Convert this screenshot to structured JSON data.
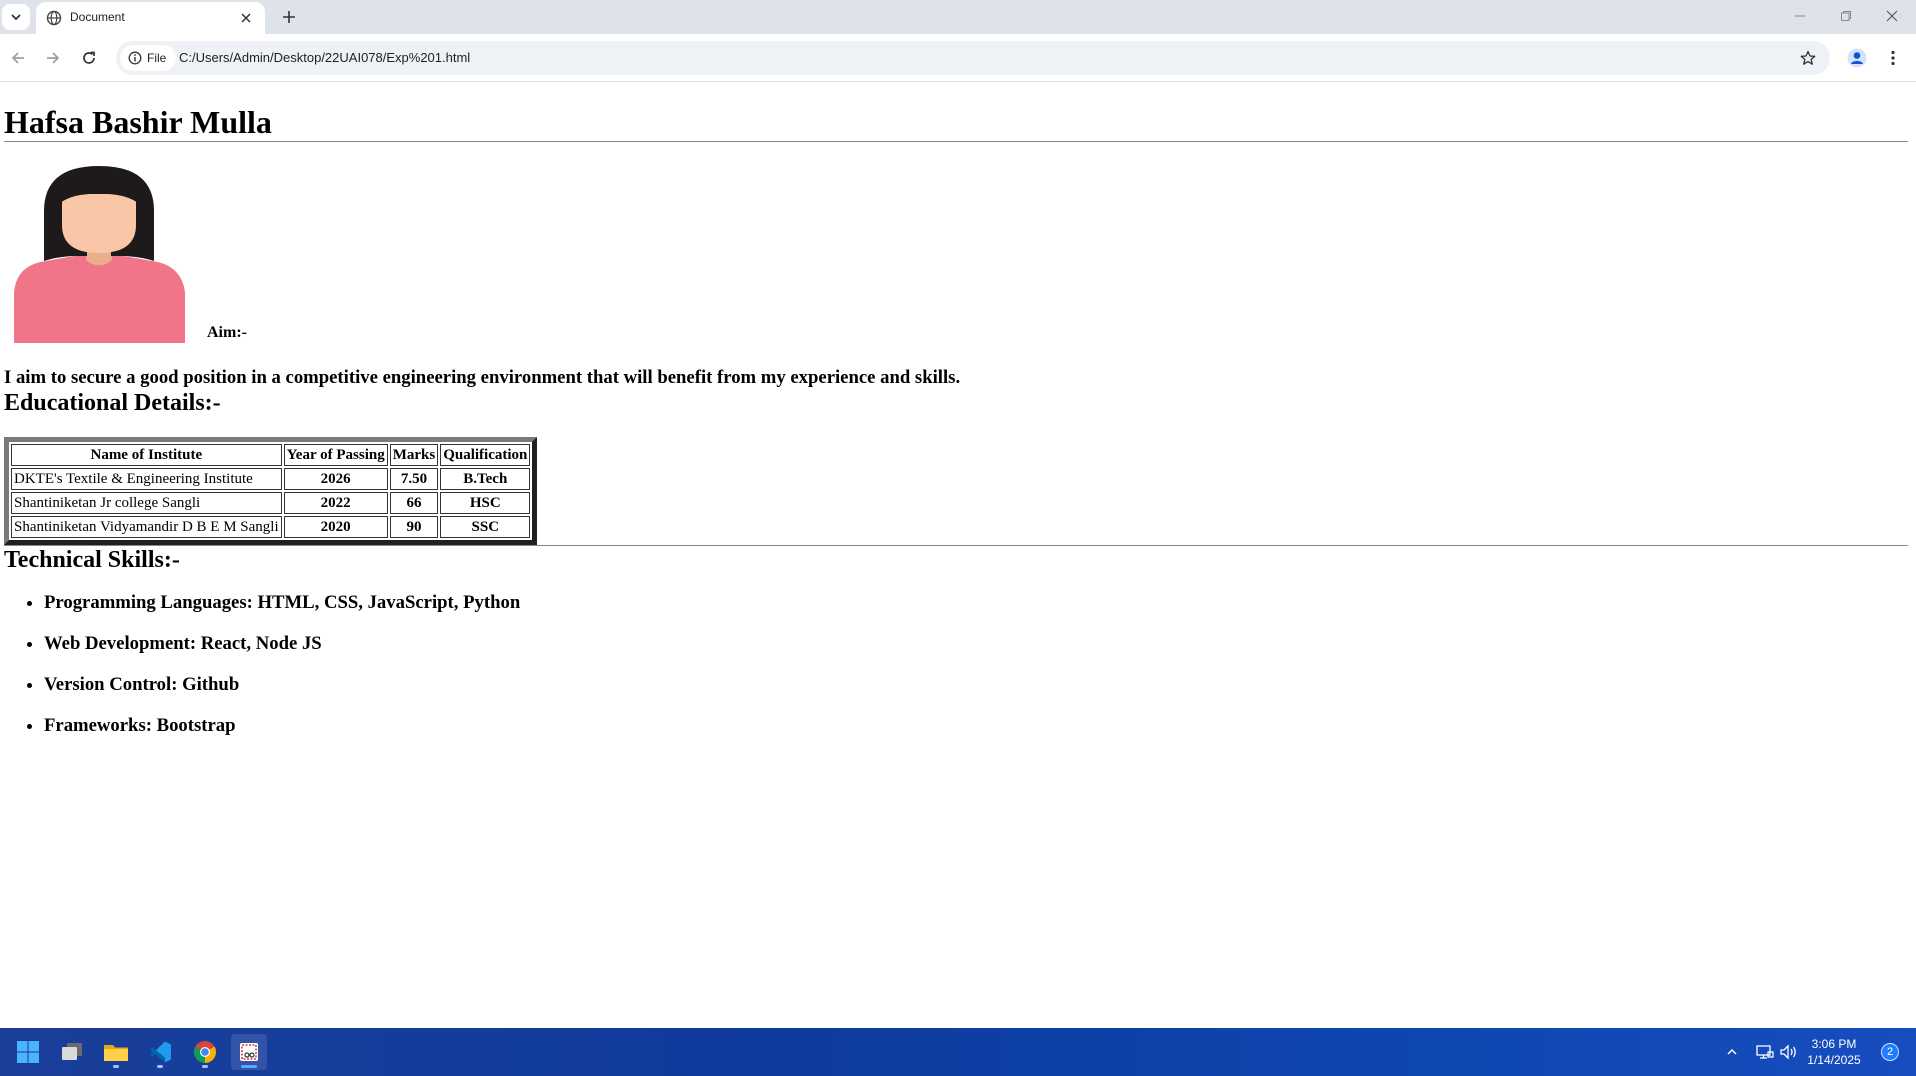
{
  "browser": {
    "tab": {
      "title": "Document",
      "favicon": "globe-icon"
    },
    "address": {
      "chip_label": "File",
      "url": "C:/Users/Admin/Desktop/22UAI078/Exp%201.html"
    },
    "icons": {
      "tab_list": "chevron-down-icon",
      "tab_close": "close-icon",
      "new_tab": "plus-icon",
      "back": "arrow-left-icon",
      "forward": "arrow-right-icon",
      "reload": "reload-icon",
      "info": "info-icon",
      "bookmark": "star-icon",
      "profile": "profile-icon",
      "menu": "kebab-menu-icon",
      "minimize": "minimize-icon",
      "restore": "restore-icon",
      "close": "close-icon"
    }
  },
  "page": {
    "name": "Hafsa Bashir Mulla",
    "aim_label": "Aim:-",
    "aim_text": "I aim to secure a good position in a competitive engineering environment that will benefit from my experience and skills.",
    "education": {
      "title": "Educational Details:-",
      "headers": [
        "Name of Institute",
        "Year of Passing",
        "Marks",
        "Qualification"
      ],
      "rows": [
        [
          "DKTE's Textile & Engineering Institute",
          "2026",
          "7.50",
          "B.Tech"
        ],
        [
          "Shantiniketan Jr college Sangli",
          "2022",
          "66",
          "HSC"
        ],
        [
          "Shantiniketan Vidyamandir D B E M Sangli",
          "2020",
          "90",
          "SSC"
        ]
      ]
    },
    "skills": {
      "title": "Technical Skills:-",
      "items": [
        "Programming Languages: HTML, CSS, JavaScript, Python",
        "Web Development: React, Node JS",
        "Version Control: Github",
        "Frameworks: Bootstrap"
      ]
    },
    "colors": {
      "avatar_shirt": "#f07588",
      "avatar_hair": "#1e1a1c",
      "avatar_skin": "#f9c6a8"
    }
  },
  "taskbar": {
    "apps": [
      "windows-start-icon",
      "task-view-icon",
      "file-explorer-icon",
      "vscode-icon",
      "chrome-icon",
      "snipping-tool-icon"
    ],
    "tray": [
      "chevron-up-icon",
      "network-icon",
      "volume-icon"
    ],
    "time": "3:06 PM",
    "date": "1/14/2025",
    "notification_count": "2",
    "color": "#0f3a9d"
  }
}
